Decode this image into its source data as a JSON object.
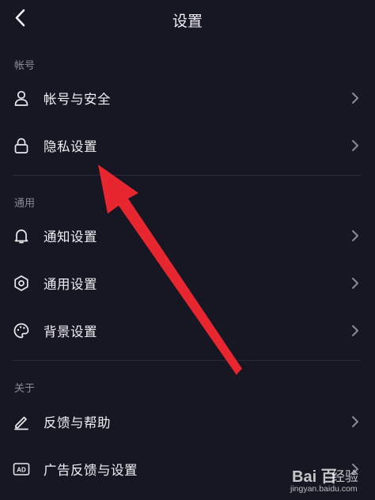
{
  "header": {
    "title": "设置",
    "back_icon": "chevron-left-icon"
  },
  "sections": {
    "account": "帐号",
    "general": "通用",
    "about": "关于"
  },
  "items": {
    "account_security": {
      "label": "帐号与安全",
      "icon": "person-icon"
    },
    "privacy": {
      "label": "隐私设置",
      "icon": "lock-icon"
    },
    "notifications": {
      "label": "通知设置",
      "icon": "bell-icon"
    },
    "general_settings": {
      "label": "通用设置",
      "icon": "gear-icon"
    },
    "background": {
      "label": "背景设置",
      "icon": "palette-icon"
    },
    "feedback_help": {
      "label": "反馈与帮助",
      "icon": "pencil-icon"
    },
    "ad_feedback": {
      "label": "广告反馈与设置",
      "icon": "ad-icon",
      "icon_text": "AD"
    }
  },
  "watermark": {
    "brand": "Bai 百",
    "cn": "经验",
    "url": "jingyan.baidu.com"
  },
  "colors": {
    "background": "#161722",
    "annotation_arrow": "#e8262f",
    "muted_text": "#8a8b96"
  }
}
